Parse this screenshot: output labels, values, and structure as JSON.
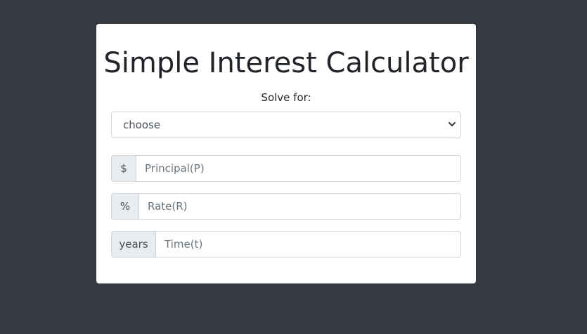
{
  "card": {
    "title": "Simple Interest Calculator",
    "solve_label": "Solve for:",
    "solve_select": {
      "selected": "choose",
      "icon": "chevron-down-icon"
    },
    "fields": [
      {
        "addon": "$",
        "placeholder": "Principal(P)"
      },
      {
        "addon": "%",
        "placeholder": "Rate(R)"
      },
      {
        "addon": "years",
        "placeholder": "Time(t)"
      }
    ]
  },
  "colors": {
    "page_background": "#343a40",
    "card_background": "#ffffff",
    "addon_background": "#e9ecef",
    "border": "#ced4da"
  }
}
